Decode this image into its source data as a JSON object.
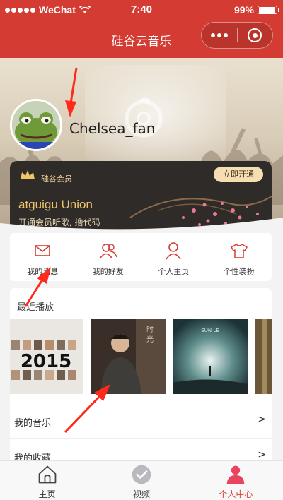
{
  "status_bar": {
    "carrier": "WeChat",
    "time": "7:40",
    "battery": "99%"
  },
  "nav": {
    "title": "硅谷云音乐"
  },
  "profile": {
    "username": "Chelsea_fan"
  },
  "vip": {
    "label": "硅谷会员",
    "button": "立即开通",
    "title": "atguigu Union",
    "subtitle": "开通会员听歌, 撸代码"
  },
  "quick_nav": {
    "items": [
      {
        "label": "我的消息",
        "icon": "mail-icon"
      },
      {
        "label": "我的好友",
        "icon": "friends-icon"
      },
      {
        "label": "个人主页",
        "icon": "person-icon"
      },
      {
        "label": "个性装扮",
        "icon": "shirt-icon"
      }
    ]
  },
  "recent": {
    "title": "最近播放"
  },
  "list": {
    "music": {
      "label": "我的音乐",
      "arrow": ">"
    },
    "favorites": {
      "label": "我的收藏",
      "arrow": ">"
    }
  },
  "tabbar": {
    "items": [
      {
        "label": "主页",
        "icon": "home-icon"
      },
      {
        "label": "视频",
        "icon": "video-icon"
      },
      {
        "label": "个人中心",
        "icon": "user-center-icon"
      }
    ],
    "active_index": 2
  },
  "colors": {
    "accent": "#d43c33",
    "vip_gold": "#f0c469",
    "annotation": "#ff2a1a"
  }
}
